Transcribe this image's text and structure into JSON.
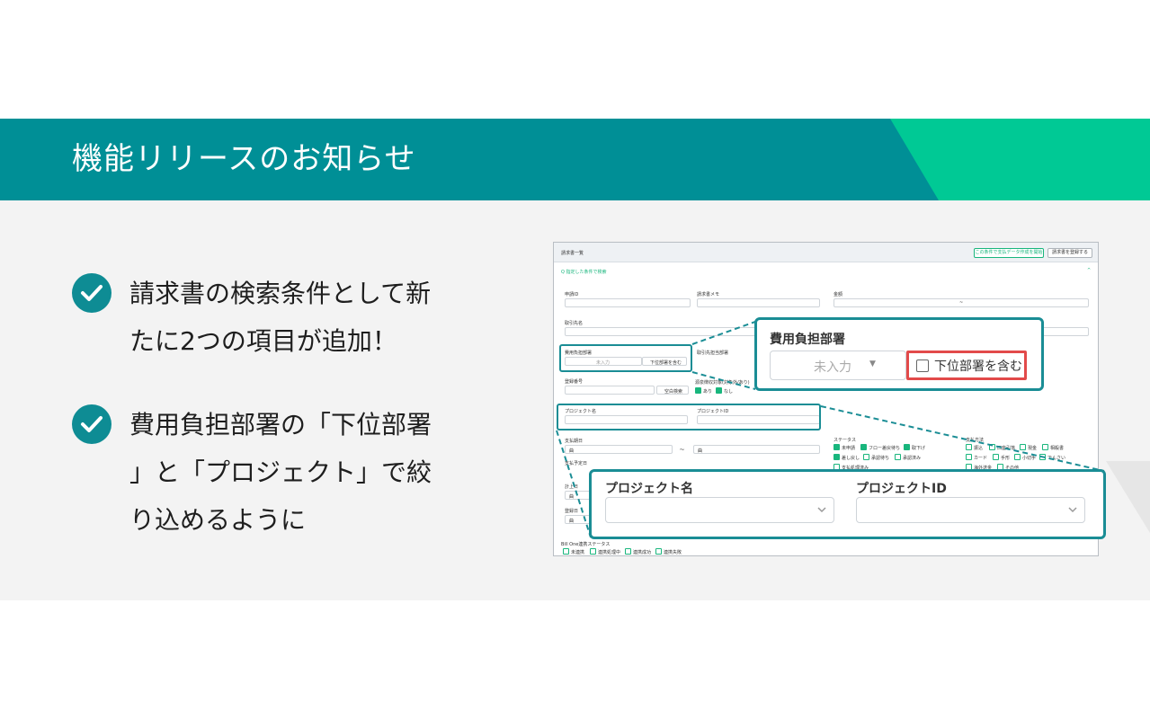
{
  "banner": {
    "title": "機能リリースのお知らせ",
    "colors": {
      "primary": "#008f96",
      "accent": "#00c995"
    }
  },
  "bullets": [
    {
      "icon": "check-circle-icon",
      "text": "請求書の検索条件として新たに2つの項目が追加！"
    },
    {
      "icon": "check-circle-icon",
      "text": "費用負担部署の「下位部署」と「プロジェクト」で絞り込めるように"
    }
  ],
  "screenshot": {
    "page_title": "請求書一覧",
    "header_buttons": [
      "この条件で支払データ作成を開始",
      "請求書を登録する"
    ],
    "search_toggle": "Q 指定した条件で検索",
    "fields": {
      "application_id": "申請ID",
      "invoice_memo": "請求書メモ",
      "amount": "金額",
      "amount_sep": "~",
      "vendor_name": "取引先名",
      "cost_dept": "費用負担部署",
      "cost_dept_value": "未入力",
      "sub_dept_check": "下位部署を含む",
      "vendor_dept": "取引先担当部署",
      "registration_no": "登録番号",
      "blank_search": "空白検索",
      "withholding": "源泉徴収対象(対象外/あり)",
      "withholding_opts": [
        "あり",
        "なし"
      ],
      "project_name": "プロジェクト名",
      "project_id": "プロジェクトID",
      "payment_date": "支払期日",
      "date_unit": "曲",
      "date_sep": "〜",
      "payment_schedule": "支払予定日",
      "booking_date": "計上日",
      "register_date": "登録日",
      "status": "ステータス",
      "status_opts": [
        "未申請",
        "フロー差戻待ち",
        "取下げ",
        "差し戻し",
        "承認待ち",
        "承認済み",
        "支払処理済み"
      ],
      "payment_method": "支払方法",
      "payment_opts": [
        "振込",
        "口座引落",
        "現金",
        "相殺書",
        "カード",
        "手形",
        "小切手",
        "でんさい",
        "海外送金",
        "その他"
      ],
      "sync_status": "Bill One連携ステータス",
      "sync_opts": [
        "未連携",
        "連携処理中",
        "連携成功",
        "連携失敗"
      ]
    },
    "callout_dept": {
      "label": "費用負担部署",
      "placeholder": "未入力",
      "checkbox": "下位部署を含む",
      "check_color": "#e24a4a"
    },
    "callout_project": {
      "name_label": "プロジェクト名",
      "id_label": "プロジェクトID"
    }
  }
}
